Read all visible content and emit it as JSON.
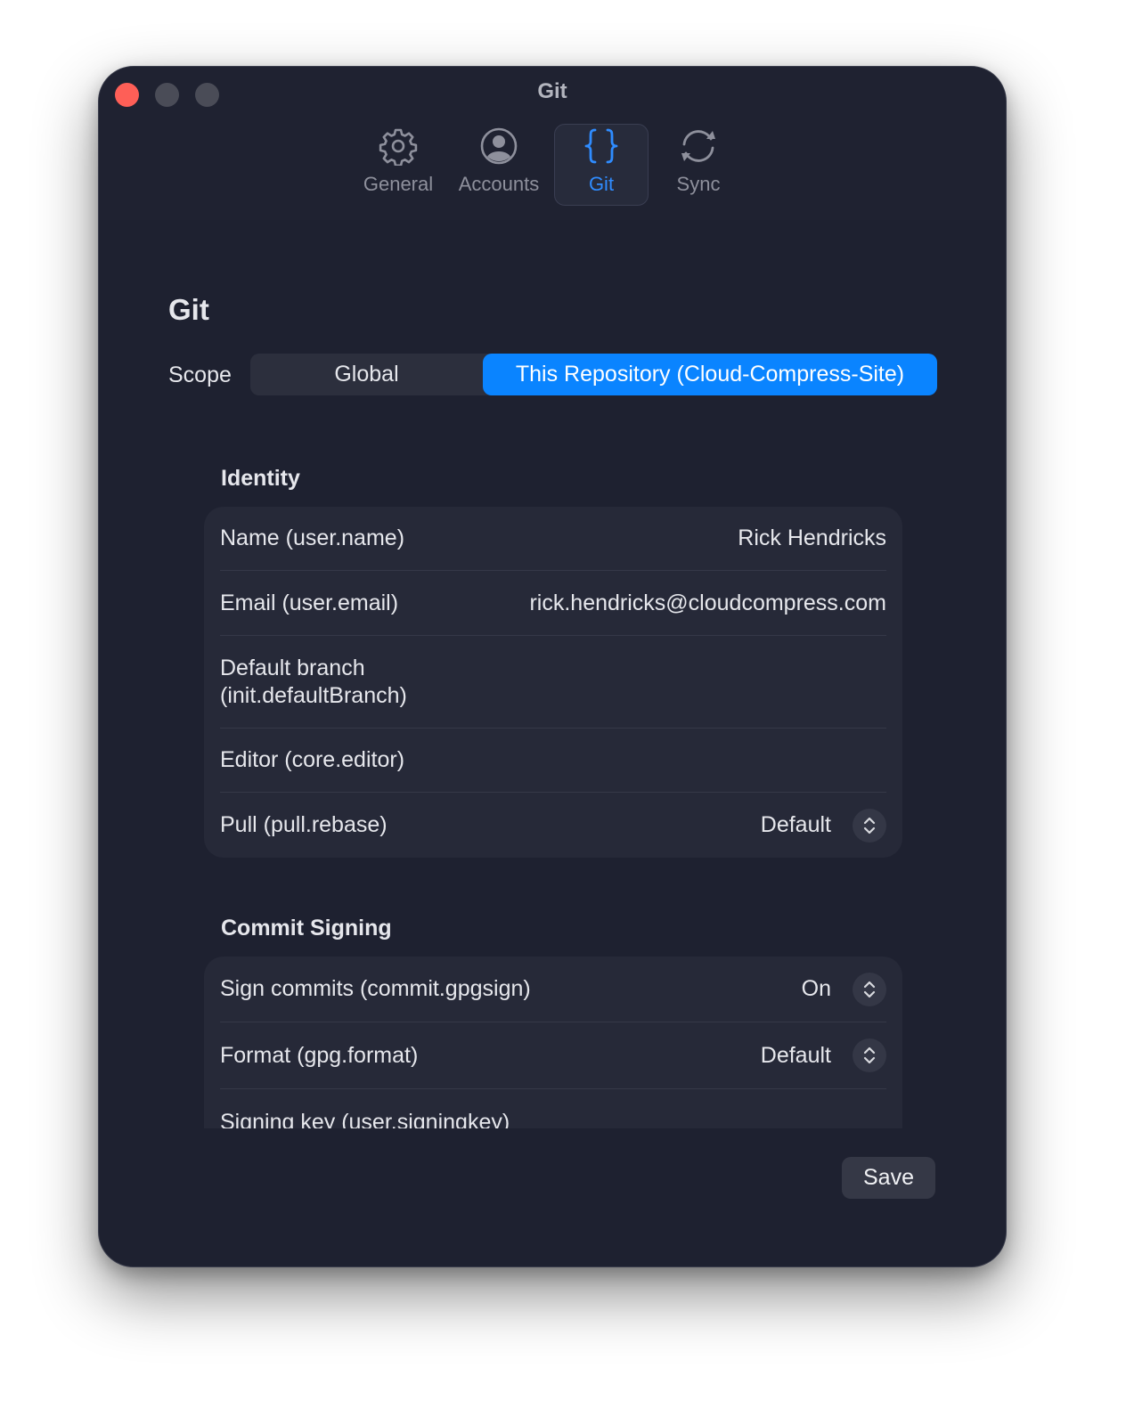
{
  "window": {
    "title": "Git"
  },
  "toolbar": {
    "tabs": [
      {
        "label": "General",
        "icon": "gear-icon"
      },
      {
        "label": "Accounts",
        "icon": "person-circle-icon"
      },
      {
        "label": "Git",
        "icon": "curly-braces-icon",
        "selected": true
      },
      {
        "label": "Sync",
        "icon": "sync-icon"
      }
    ]
  },
  "page": {
    "title": "Git",
    "scope_label": "Scope",
    "scope_options": [
      "Global",
      "This Repository (Cloud-Compress-Site)"
    ],
    "scope_selected": "This Repository (Cloud-Compress-Site)"
  },
  "identity": {
    "title": "Identity",
    "rows": [
      {
        "label": "Name (user.name)",
        "value": "Rick Hendricks"
      },
      {
        "label": "Email (user.email)",
        "value": "rick.hendricks@cloudcompress.com"
      },
      {
        "label_line1": "Default branch",
        "label_line2": "(init.defaultBranch)",
        "value": ""
      },
      {
        "label": "Editor (core.editor)",
        "value": ""
      },
      {
        "label": "Pull (pull.rebase)",
        "value": "Default"
      }
    ]
  },
  "signing": {
    "title": "Commit Signing",
    "rows": [
      {
        "label": "Sign commits (commit.gpgsign)",
        "value": "On"
      },
      {
        "label": "Format (gpg.format)",
        "value": "Default"
      },
      {
        "label": "Signing key (user.signingkey)",
        "value": ""
      }
    ]
  },
  "footer": {
    "save_label": "Save"
  },
  "colors": {
    "accent": "#0a84ff",
    "window_bg": "#1e2130",
    "group_bg": "#262938",
    "close": "#fe5f57"
  }
}
